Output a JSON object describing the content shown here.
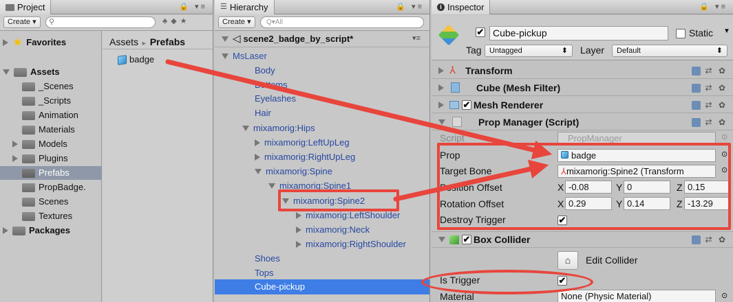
{
  "project": {
    "tab_label": "Project",
    "create_label": "Create",
    "breadcrumb": {
      "root": "Assets",
      "sep": "►",
      "current": "Prefabs"
    },
    "favorites_label": "Favorites",
    "assets_label": "Assets",
    "folders": [
      "_Scenes",
      "_Scripts",
      "Animation",
      "Materials",
      "Models",
      "Plugins",
      "Prefabs",
      "PropBadge.",
      "Scenes",
      "Textures"
    ],
    "packages_label": "Packages",
    "file_item": "badge"
  },
  "hierarchy": {
    "tab_label": "Hierarchy",
    "create_label": "Create",
    "search_placeholder": "Q▾All",
    "scene_name": "scene2_badge_by_script*",
    "items": [
      "MsLaser",
      "Body",
      "Bottoms",
      "Eyelashes",
      "Hair",
      "mixamorig:Hips",
      "mixamorig:LeftUpLeg",
      "mixamorig:RightUpLeg",
      "mixamorig:Spine",
      "mixamorig:Spine1",
      "mixamorig:Spine2",
      "mixamorig:LeftShoulder",
      "mixamorig:Neck",
      "mixamorig:RightShoulder",
      "Shoes",
      "Tops",
      "Cube-pickup"
    ]
  },
  "inspector": {
    "tab_label": "Inspector",
    "object_name": "Cube-pickup",
    "static_label": "Static",
    "tag_label": "Tag",
    "tag_value": "Untagged",
    "layer_label": "Layer",
    "layer_value": "Default",
    "components": {
      "transform": "Transform",
      "mesh_filter": "Cube (Mesh Filter)",
      "mesh_renderer": "Mesh Renderer",
      "prop_manager": "Prop Manager (Script)",
      "box_collider": "Box Collider"
    },
    "script_label": "Script",
    "script_value": "PropManager",
    "prop_label": "Prop",
    "prop_value": "badge",
    "target_bone_label": "Target Bone",
    "target_bone_value": "mixamorig:Spine2 (Transform",
    "position_label": "Position Offset",
    "position": {
      "x": "-0.08",
      "y": "0",
      "z": "0.15"
    },
    "rotation_label": "Rotation Offset",
    "rotation": {
      "x": "0.29",
      "y": "0.14",
      "z": "-13.29"
    },
    "destroy_trigger_label": "Destroy Trigger",
    "edit_collider_label": "Edit Collider",
    "is_trigger_label": "Is Trigger",
    "material_label": "Material",
    "material_value": "None (Physic Material)",
    "axis": {
      "x": "X",
      "y": "Y",
      "z": "Z"
    }
  },
  "colors": {
    "annotation": "#e8453c",
    "selection": "#3e7de6",
    "folder_selected": "#8e98a8"
  }
}
